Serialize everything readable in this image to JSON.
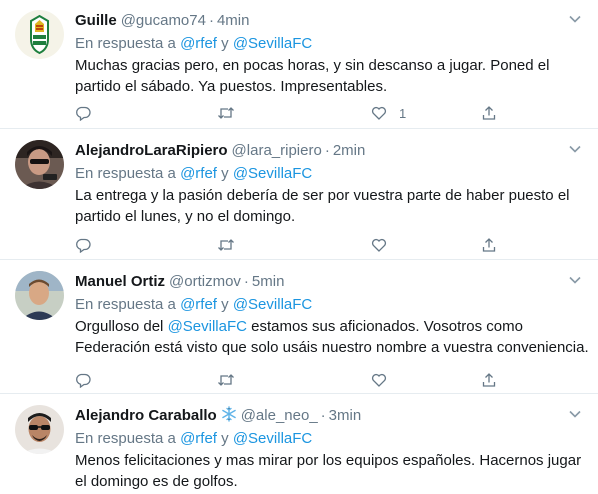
{
  "reply_prefix": "En respuesta a",
  "reply_conjunction": "y",
  "tweets": [
    {
      "name": "Guille",
      "handle": "@gucamo74",
      "time": "4min",
      "reply_to": [
        "@rfef",
        "@SevillaFC"
      ],
      "text_lines": [
        "Muchas gracias pero, en pocas horas, y sin descanso a jugar. Poned el",
        "partido el sábado. Ya puestos. Impresentables."
      ],
      "likes": "1"
    },
    {
      "name": "AlejandroLaraRipiero",
      "handle": "@lara_ripiero",
      "time": "2min",
      "reply_to": [
        "@rfef",
        "@SevillaFC"
      ],
      "text_lines": [
        "La entrega y la pasión debería de ser por vuestra parte de haber puesto el",
        "partido el lunes, y no el domingo."
      ],
      "likes": ""
    },
    {
      "name": "Manuel Ortiz",
      "handle": "@ortizmov",
      "time": "5min",
      "reply_to": [
        "@rfef",
        "@SevillaFC"
      ],
      "text_lines": [
        "Orgulloso del ",
        "@SevillaFC",
        " estamos sus aficionados. Vosotros como",
        "Federación está visto que solo usáis nuestro nombre a vuestra conveniencia."
      ],
      "likes": ""
    },
    {
      "name": "Alejandro Caraballo",
      "handle": "@ale_neo_",
      "time": "3min",
      "reply_to": [
        "@rfef",
        "@SevillaFC"
      ],
      "text_lines": [
        "Menos felicitaciones y mas mirar por los equipos españoles. Hacernos jugar",
        "el domingo es de golfos."
      ],
      "likes": ""
    }
  ],
  "colors": {
    "link": "#1b95e0",
    "muted": "#657786",
    "text": "#14171a",
    "divider": "#e6ecf0"
  },
  "icons": [
    "chevron-down-icon",
    "reply-icon",
    "retweet-icon",
    "like-icon",
    "share-icon",
    "snowflake-icon"
  ]
}
